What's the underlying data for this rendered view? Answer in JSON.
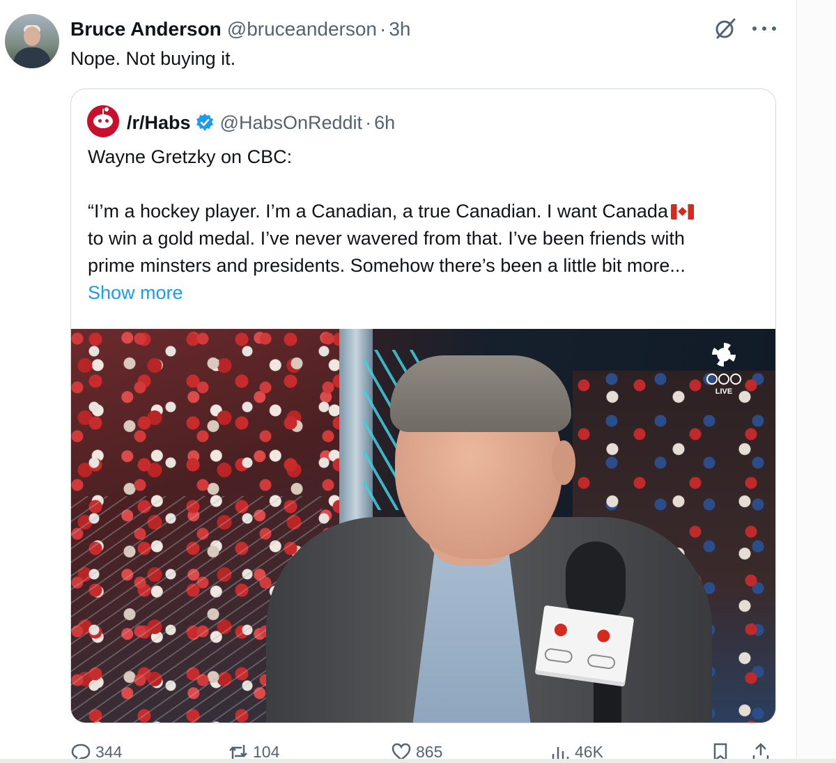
{
  "tweet": {
    "author_name": "Bruce Anderson",
    "author_handle": "@bruceanderson",
    "separator": "·",
    "time": "3h",
    "text": "Nope.  Not buying it.",
    "icons": {
      "grok": "grok-icon",
      "more": "more-icon"
    }
  },
  "quote": {
    "author_name": "/r/Habs",
    "verified": true,
    "author_handle": "@HabsOnReddit",
    "separator": "·",
    "time": "6h",
    "line1": "Wayne Gretzky on CBC:",
    "line2": "“I’m a hockey player. I’m a Canadian, a true Canadian. I want Canada",
    "line3": "to win a gold medal. I’ve never wavered from that. I’ve been friends with",
    "line4": "prime minsters and presidents. Somehow there’s been a little bit more...",
    "show_more": "Show more",
    "media": {
      "overlay_logo_label": "LIVE",
      "description_icon": "cbc-olympics-logo"
    }
  },
  "actions": {
    "reply_count": "344",
    "retweet_count": "104",
    "like_count": "865",
    "view_count": "46K"
  },
  "colors": {
    "link": "#1d9bf0",
    "secondary_text": "#536471",
    "primary_text": "#0f1419",
    "border": "#cfd9de"
  }
}
